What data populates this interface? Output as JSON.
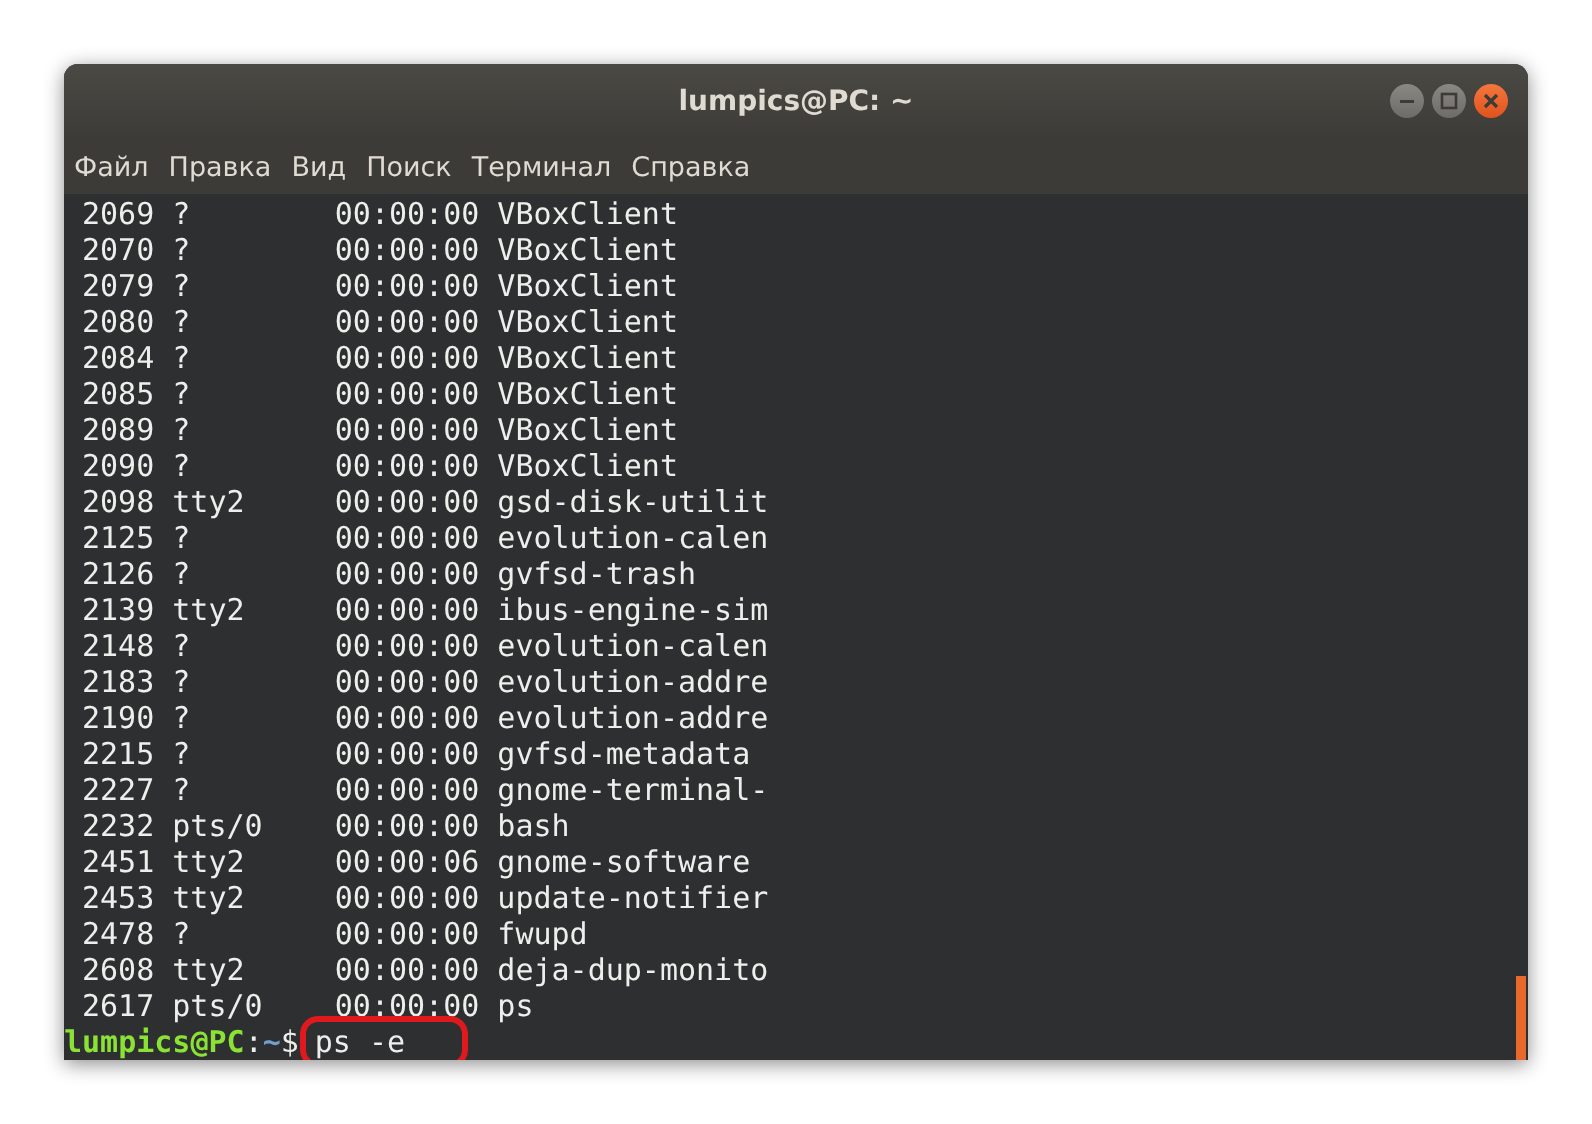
{
  "window": {
    "title": "lumpics@PC: ~"
  },
  "menu": [
    "Файл",
    "Правка",
    "Вид",
    "Поиск",
    "Терминал",
    "Справка"
  ],
  "terminal": {
    "rows": [
      {
        "pid": "2069",
        "tty": "?",
        "time": "00:00:00",
        "command": "VBoxClient"
      },
      {
        "pid": "2070",
        "tty": "?",
        "time": "00:00:00",
        "command": "VBoxClient"
      },
      {
        "pid": "2079",
        "tty": "?",
        "time": "00:00:00",
        "command": "VBoxClient"
      },
      {
        "pid": "2080",
        "tty": "?",
        "time": "00:00:00",
        "command": "VBoxClient"
      },
      {
        "pid": "2084",
        "tty": "?",
        "time": "00:00:00",
        "command": "VBoxClient"
      },
      {
        "pid": "2085",
        "tty": "?",
        "time": "00:00:00",
        "command": "VBoxClient"
      },
      {
        "pid": "2089",
        "tty": "?",
        "time": "00:00:00",
        "command": "VBoxClient"
      },
      {
        "pid": "2090",
        "tty": "?",
        "time": "00:00:00",
        "command": "VBoxClient"
      },
      {
        "pid": "2098",
        "tty": "tty2",
        "time": "00:00:00",
        "command": "gsd-disk-utilit"
      },
      {
        "pid": "2125",
        "tty": "?",
        "time": "00:00:00",
        "command": "evolution-calen"
      },
      {
        "pid": "2126",
        "tty": "?",
        "time": "00:00:00",
        "command": "gvfsd-trash"
      },
      {
        "pid": "2139",
        "tty": "tty2",
        "time": "00:00:00",
        "command": "ibus-engine-sim"
      },
      {
        "pid": "2148",
        "tty": "?",
        "time": "00:00:00",
        "command": "evolution-calen"
      },
      {
        "pid": "2183",
        "tty": "?",
        "time": "00:00:00",
        "command": "evolution-addre"
      },
      {
        "pid": "2190",
        "tty": "?",
        "time": "00:00:00",
        "command": "evolution-addre"
      },
      {
        "pid": "2215",
        "tty": "?",
        "time": "00:00:00",
        "command": "gvfsd-metadata"
      },
      {
        "pid": "2227",
        "tty": "?",
        "time": "00:00:00",
        "command": "gnome-terminal-"
      },
      {
        "pid": "2232",
        "tty": "pts/0",
        "time": "00:00:00",
        "command": "bash"
      },
      {
        "pid": "2451",
        "tty": "tty2",
        "time": "00:00:06",
        "command": "gnome-software"
      },
      {
        "pid": "2453",
        "tty": "tty2",
        "time": "00:00:00",
        "command": "update-notifier"
      },
      {
        "pid": "2478",
        "tty": "?",
        "time": "00:00:00",
        "command": "fwupd"
      },
      {
        "pid": "2608",
        "tty": "tty2",
        "time": "00:00:00",
        "command": "deja-dup-monito"
      },
      {
        "pid": "2617",
        "tty": "pts/0",
        "time": "00:00:00",
        "command": "ps"
      }
    ],
    "prompt": {
      "user_host": "lumpics@PC",
      "separator": ":",
      "path": "~",
      "symbol": "$",
      "command": "ps -e",
      "highlighted": true
    }
  }
}
